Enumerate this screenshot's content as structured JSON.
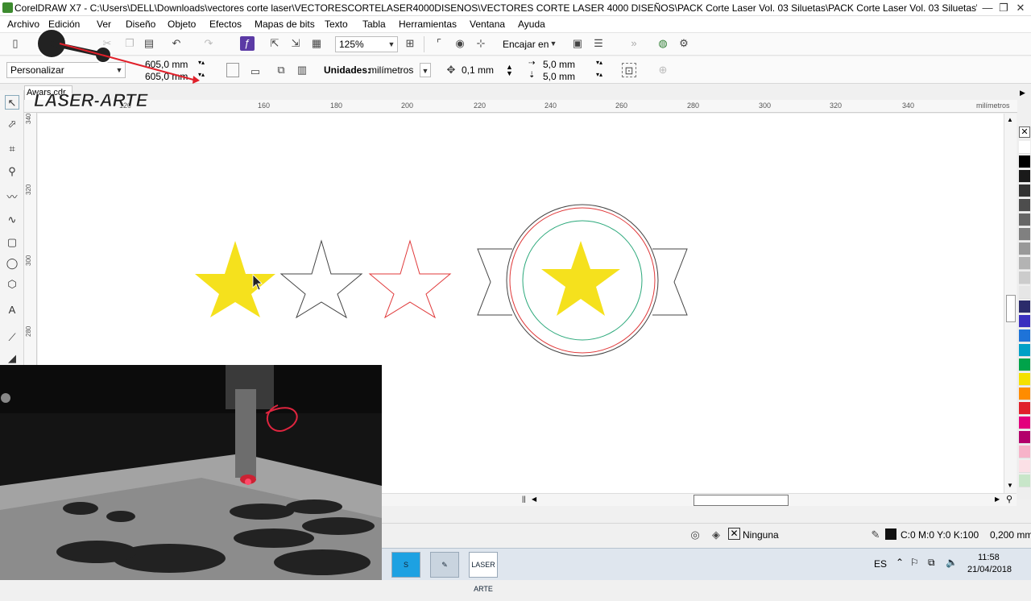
{
  "window": {
    "title": "CorelDRAW X7 - C:\\Users\\DELL\\Downloads\\vectores corte laser\\VECTORESCORTELASER4000DISENOS\\VECTORES CORTE LASER 4000 DISEÑOS\\PACK Corte Laser Vol. 03 Siluetas\\PACK Corte Laser Vol. 03 Siluetas\\Siluetas\\Siluet...",
    "minimize": "—",
    "maximize": "❐",
    "close": "✕"
  },
  "menu": [
    "Archivo",
    "Edición",
    "Ver",
    "Diseño",
    "Objeto",
    "Efectos",
    "Mapas de bits",
    "Texto",
    "Tabla",
    "Herramientas",
    "Ventana",
    "Ayuda"
  ],
  "toolbar": {
    "zoom_value": "125%",
    "snap_label": "Encajar en"
  },
  "property_bar": {
    "preset_value": "Personalizar",
    "width_value": "605,0 mm",
    "height_value": "605,0 mm",
    "units_label": "Unidades:",
    "units_value": "milímetros",
    "nudge_value": "0,1 mm",
    "dup_x_value": "5,0 mm",
    "dup_y_value": "5,0 mm"
  },
  "document": {
    "tab_label": "Awars.cdr"
  },
  "ruler": {
    "unit_label": "milímetros",
    "h_ticks": [
      "120",
      "160",
      "180",
      "200",
      "220",
      "240",
      "260",
      "280",
      "300",
      "320",
      "340"
    ],
    "v_ticks": [
      "340",
      "320",
      "300",
      "280"
    ]
  },
  "logo": {
    "text": "LASER-ARTE"
  },
  "status": {
    "fill_label": "Ninguna",
    "outline_label": "C:0 M:0 Y:0 K:100",
    "outline_width": "0,200 mm"
  },
  "taskbar": {
    "app_label": "LASER ARTE",
    "lang": "ES",
    "time": "11:58",
    "date": "21/04/2018"
  },
  "colors": {
    "star_fill": "#f5e11d",
    "outline_red": "#e0393a",
    "outline_green": "#2aa87a",
    "outline_dark": "#444444"
  },
  "palette": [
    "#ffffff",
    "#000000",
    "#1a1a1a",
    "#333333",
    "#4d4d4d",
    "#666666",
    "#808080",
    "#999999",
    "#b3b3b3",
    "#cccccc",
    "#e6e6e6",
    "#2b2b6b",
    "#3a2fbf",
    "#1e73d8",
    "#00a0c6",
    "#00a34a",
    "#f4e100",
    "#ff8c00",
    "#e0202a",
    "#e3007d",
    "#b3006b",
    "#f7b3c9",
    "#fbe0e6",
    "#c8e6c9"
  ]
}
